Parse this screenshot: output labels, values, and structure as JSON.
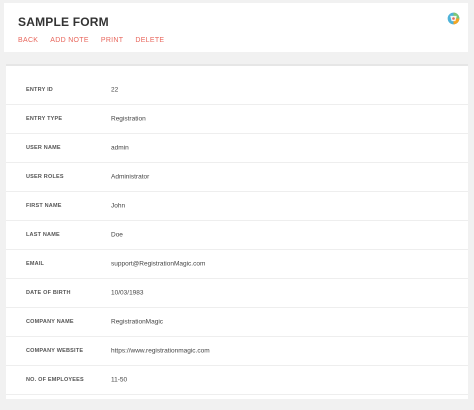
{
  "header": {
    "title": "SAMPLE FORM",
    "logo_icon": "registrationmagic-logo-icon",
    "actions": [
      "BACK",
      "ADD NOTE",
      "PRINT",
      "DELETE"
    ],
    "action_color": "#e8665c"
  },
  "entry": {
    "rows": [
      {
        "label": "ENTRY ID",
        "value": "22"
      },
      {
        "label": "ENTRY TYPE",
        "value": "Registration"
      },
      {
        "label": "USER NAME",
        "value": "admin"
      },
      {
        "label": "USER ROLES",
        "value": "Administrator"
      },
      {
        "label": "FIRST NAME",
        "value": "John"
      },
      {
        "label": "LAST NAME",
        "value": "Doe"
      },
      {
        "label": "EMAIL",
        "value": "support@RegistrationMagic.com"
      },
      {
        "label": "DATE OF BIRTH",
        "value": "10/03/1983"
      },
      {
        "label": "COMPANY NAME",
        "value": "RegistrationMagic"
      },
      {
        "label": "COMPANY WEBSITE",
        "value": "https://www.registrationmagic.com"
      },
      {
        "label": "NO. OF EMPLOYEES",
        "value": "11-50"
      }
    ]
  }
}
